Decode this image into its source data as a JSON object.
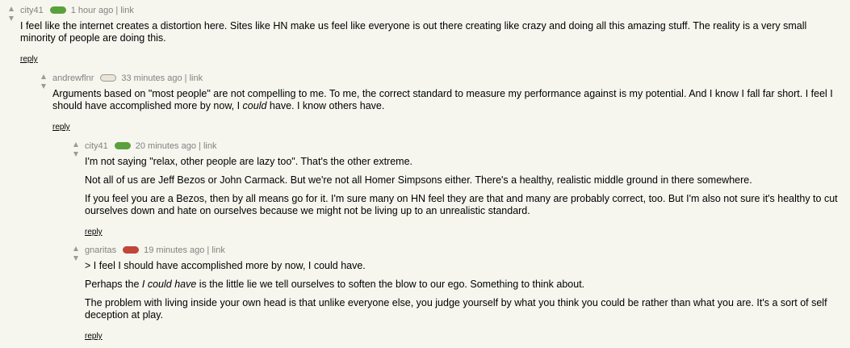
{
  "comments": [
    {
      "user": "city41",
      "badge_color": "#5aa03c",
      "age": "1 hour ago",
      "separator": "|",
      "link_label": "link",
      "paragraphs": [
        "I feel like the internet creates a distortion here. Sites like HN make us feel like everyone is out there creating like crazy and doing all this amazing stuff. The reality is a very small minority of people are doing this."
      ],
      "reply_label": "reply"
    },
    {
      "user": "andrewflnr",
      "badge_color": "#eae5d8",
      "age": "33 minutes ago",
      "separator": "|",
      "link_label": "link",
      "p1_before": "Arguments based on \"most people\" are not compelling to me. To me, the correct standard to measure my performance against is my potential. And I know I fall far short. I feel I should have accomplished more by now, I ",
      "p1_em": "could",
      "p1_after": " have. I know others have.",
      "reply_label": "reply"
    },
    {
      "user": "city41",
      "badge_color": "#5aa03c",
      "age": "20 minutes ago",
      "separator": "|",
      "link_label": "link",
      "paragraphs": [
        "I'm not saying \"relax, other people are lazy too\". That's the other extreme.",
        "Not all of us are Jeff Bezos or John Carmack. But we're not all Homer Simpsons either. There's a healthy, realistic middle ground in there somewhere.",
        "If you feel you are a Bezos, then by all means go for it. I'm sure many on HN feel they are that and many are probably correct, too. But I'm also not sure it's healthy to cut ourselves down and hate on ourselves because we might not be living up to an unrealistic standard."
      ],
      "reply_label": "reply"
    },
    {
      "user": "gnaritas",
      "badge_color": "#c0453a",
      "age": "19 minutes ago",
      "separator": "|",
      "link_label": "link",
      "p1": "> I feel I should have accomplished more by now, I could have.",
      "p2_before": "Perhaps the ",
      "p2_em": "I could have",
      "p2_after": " is the little lie we tell ourselves to soften the blow to our ego. Something to think about.",
      "p3": "The problem with living inside your own head is that unlike everyone else, you judge yourself by what you think you could be rather than what you are. It's a sort of self deception at play.",
      "reply_label": "reply"
    }
  ]
}
